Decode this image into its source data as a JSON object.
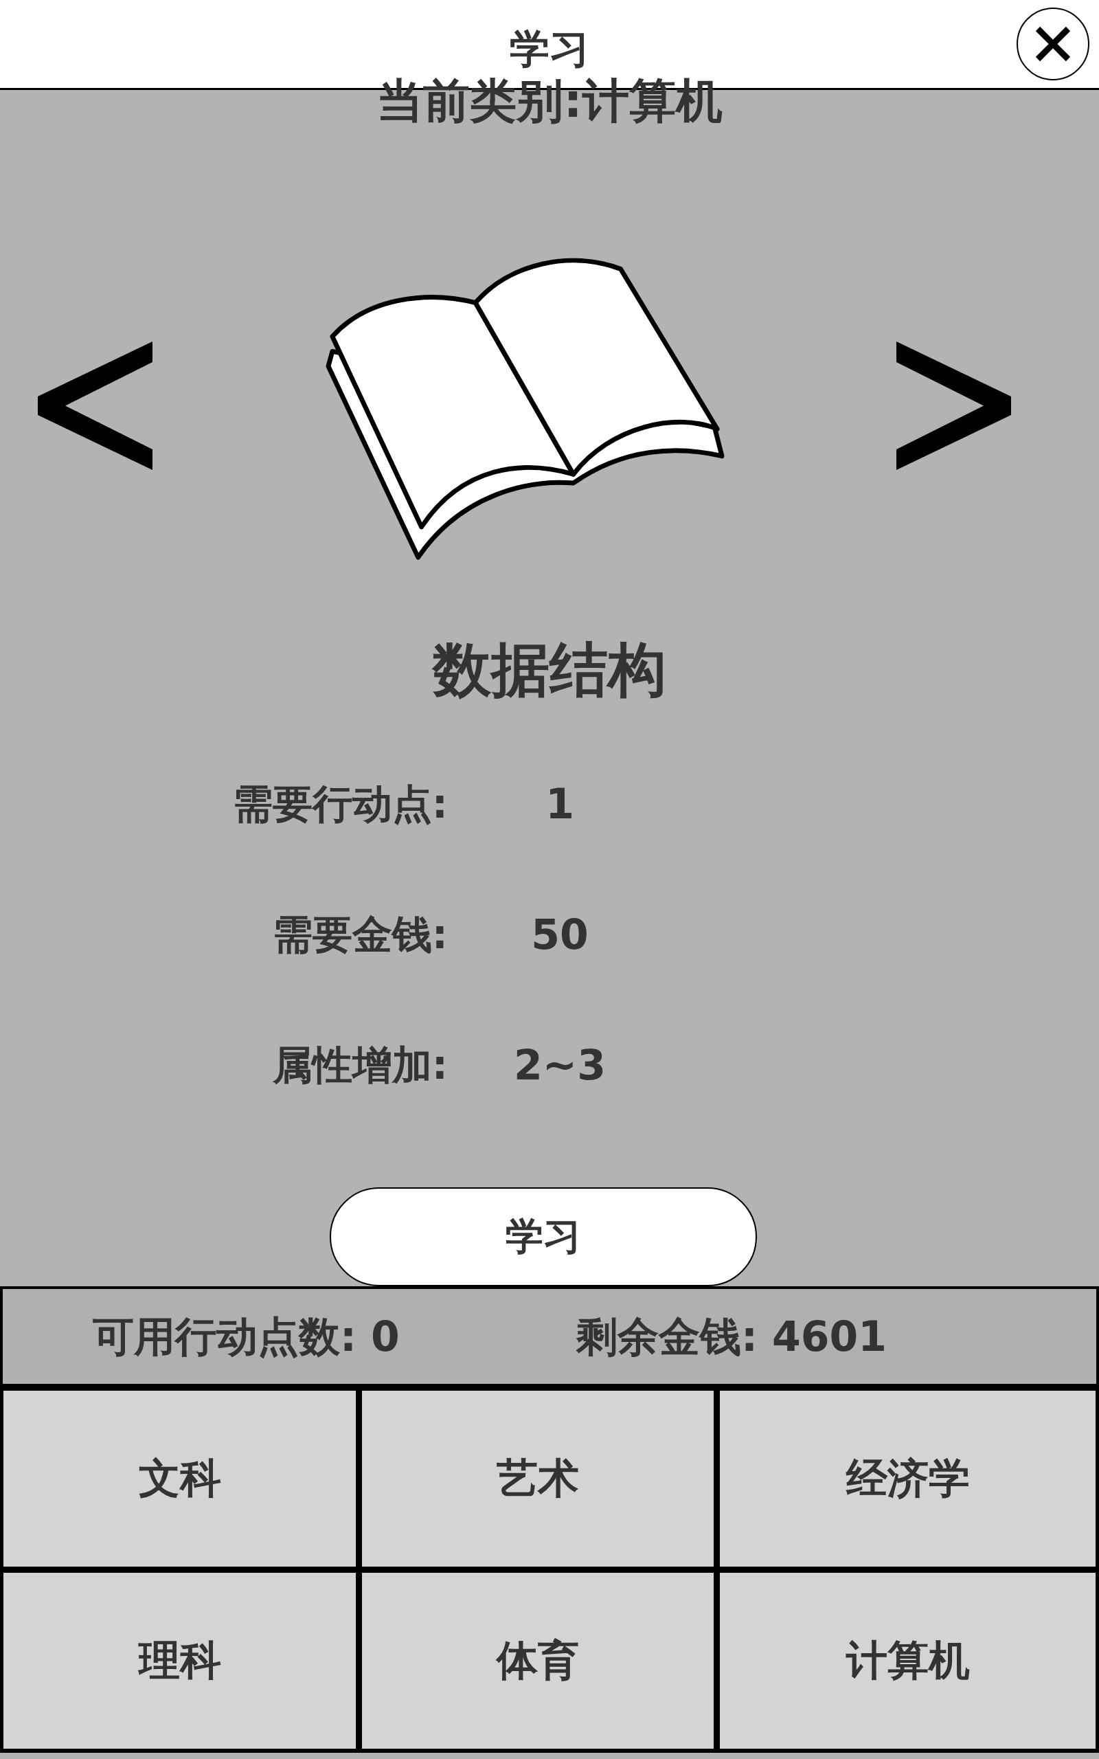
{
  "header": {
    "title": "学习"
  },
  "category_label": "当前类别:计算机",
  "course": {
    "name": "数据结构",
    "stats": [
      {
        "label": "需要行动点:",
        "value": "1"
      },
      {
        "label": "需要金钱:",
        "value": "50"
      },
      {
        "label": "属性增加:",
        "value": "2~3"
      }
    ]
  },
  "study_button": {
    "label": "学习"
  },
  "status_bar": [
    {
      "text": "可用行动点数: 0"
    },
    {
      "text": "剩余金钱: 4601"
    }
  ],
  "categories": [
    {
      "label": "文科"
    },
    {
      "label": "艺术"
    },
    {
      "label": "经济学"
    },
    {
      "label": "理科"
    },
    {
      "label": "体育"
    },
    {
      "label": "计算机"
    }
  ]
}
